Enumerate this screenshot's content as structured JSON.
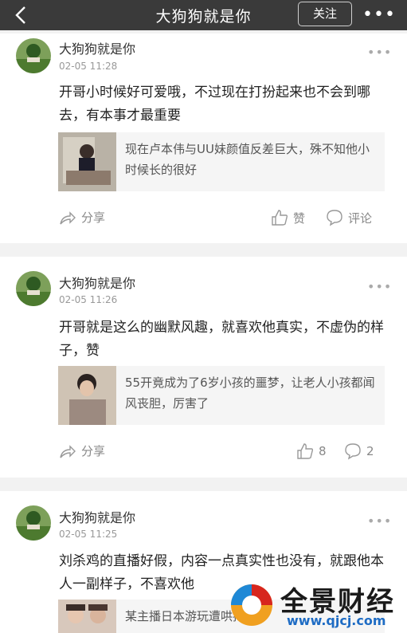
{
  "header": {
    "title": "大狗狗就是你",
    "follow_label": "关注",
    "more_label": "•••"
  },
  "posts": [
    {
      "user": "大狗狗就是你",
      "time": "02-05 11:28",
      "more": "•••",
      "text": "开哥小时候好可爱哦，不过现在打扮起来也不会到哪去，有本事才最重要",
      "quote": "现在卢本伟与UU妹颜值反差巨大，殊不知他小时候长的很好",
      "share": "分享",
      "like": "赞",
      "comment": "评论"
    },
    {
      "user": "大狗狗就是你",
      "time": "02-05 11:26",
      "more": "•••",
      "text": "开哥就是这么的幽默风趣，就喜欢他真实，不虚伪的样子，赞",
      "quote": "55开竟成为了6岁小孩的噩梦，让老人小孩都闻风丧胆，厉害了",
      "share": "分享",
      "like": "8",
      "comment": "2"
    },
    {
      "user": "大狗狗就是你",
      "time": "02-05 11:25",
      "more": "•••",
      "text": "刘杀鸡的直播好假，内容一点真实性也没有，就跟他本人一副样子，不喜欢他",
      "quote": "某主播日本游玩遭哄抢"
    }
  ],
  "watermark": {
    "brand": "全景财经",
    "url": "www.qjcj.com"
  }
}
